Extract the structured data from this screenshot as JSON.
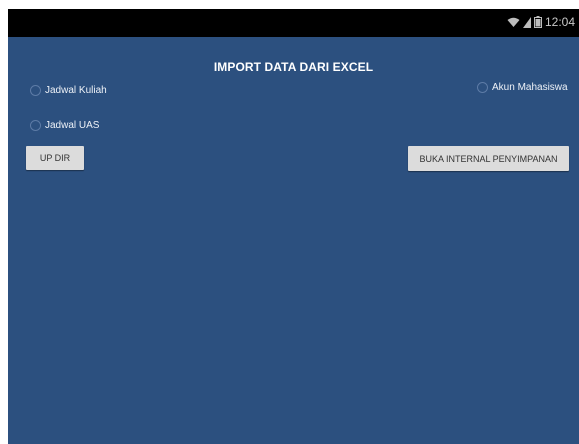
{
  "status_bar": {
    "time": "12:04",
    "icons": [
      "wifi-icon",
      "signal-icon",
      "battery-icon"
    ]
  },
  "screen": {
    "title": "IMPORT DATA DARI EXCEL",
    "radios": {
      "jadwal_kuliah": "Jadwal Kuliah",
      "akun_mahasiswa": "Akun Mahasiswa",
      "jadwal_uas": "Jadwal UAS"
    },
    "buttons": {
      "up_dir": "UP DIR",
      "buka_internal": "BUKA INTERNAL PENYIMPANAN"
    }
  },
  "colors": {
    "background": "#2c507f",
    "status_bar": "#000000",
    "button": "#dcdcdc"
  }
}
